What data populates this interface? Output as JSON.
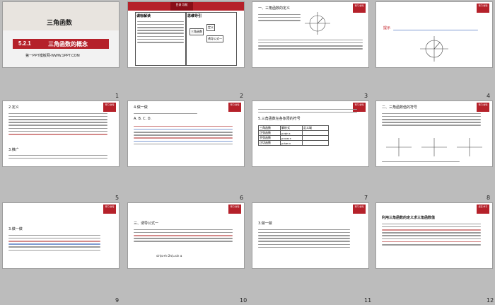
{
  "grid_title": "PPT slide sorter",
  "slides": [
    {
      "n": "1",
      "title": "三角函数",
      "section_no": "5.2.1",
      "section_title": "三角函数的概念",
      "footer": "第一PPT模板网-WWW.1PPT.COM"
    },
    {
      "n": "2",
      "badge": "目录\n导航",
      "h1": "课标解读",
      "h2": "思维导引",
      "t1": "1.结合单位圆，理解三角函数的定义……",
      "c1": "三角函数",
      "c2": "定义",
      "c3": "诱导公式一"
    },
    {
      "n": "3",
      "badge": "预习\n新知",
      "head": "一、三角函数的定义",
      "t1": "1.任意角的三角函数：如图……",
      "p": "P(x,y)"
    },
    {
      "n": "4",
      "badge": "预习\n新知",
      "prompt": "提示",
      "t1": "sin α=y, cos α=x, tan α=y/x ……"
    },
    {
      "n": "5",
      "badge": "预习\n新知",
      "head": "2.定义",
      "t1": "如果点P……",
      "note": "3.推广"
    },
    {
      "n": "6",
      "badge": "预习\n新知",
      "head": "4.做一做",
      "t1": "已知角α的终边经过点(1,-√3)……",
      "opts": "A.  B.  C.  D."
    },
    {
      "n": "7",
      "badge": "预习\n新知",
      "head": "5.三角函数在各象限的符号",
      "table": [
        [
          "三角函数",
          "解析式",
          "定义域"
        ],
        [
          "正弦函数",
          "y=sin x",
          ""
        ],
        [
          "余弦函数",
          "y=cos x",
          ""
        ],
        [
          "正切函数",
          "y=tan x",
          ""
        ]
      ]
    },
    {
      "n": "8",
      "badge": "预习\n新知",
      "head": "二、三角函数值的符号",
      "t1": "1.根据三角函数定义……",
      "q": "Ⅰ Ⅱ Ⅲ Ⅳ"
    },
    {
      "n": "9",
      "badge": "预习\n新知",
      "head": "3.做一做",
      "t1": "判断下列各式的符号：(1)sin 105°……"
    },
    {
      "n": "10",
      "badge": "预习\n新知",
      "head": "三、诱导公式一",
      "t1": "1.30°，390°，-330°……",
      "f": "sin(α+k·2π)=sin α"
    },
    {
      "n": "11",
      "badge": "预习\n新知",
      "head": "3.做一做",
      "t1": "求值：(1)sin 780°……"
    },
    {
      "n": "12",
      "badge": "探究\n学习",
      "head": "利用三角函数的定义求三角函数值",
      "t1": "例1 求下列各角……",
      "ex": "例1"
    }
  ]
}
